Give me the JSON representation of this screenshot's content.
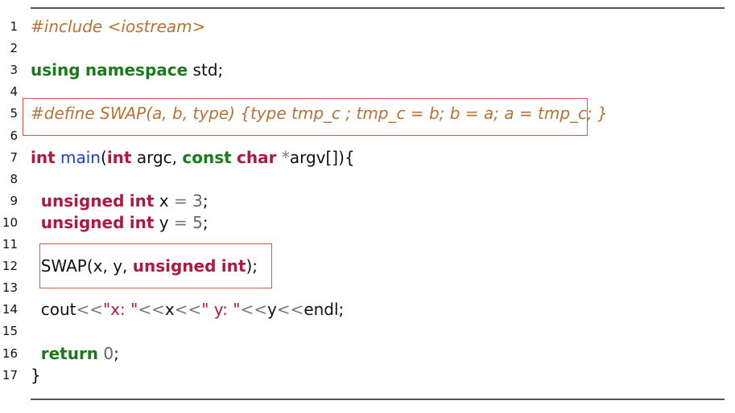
{
  "colors": {
    "preprocessor": "#b87333",
    "keyword_green": "#1b7a1b",
    "type_red": "#b0183d",
    "function_blue": "#1a3fd6",
    "operator_gray": "#777777",
    "number_gray": "#666666",
    "string_red": "#b0183d",
    "text": "#111111",
    "highlight_box": "#d9534f"
  },
  "lines": [
    {
      "n": "1",
      "tokens": [
        {
          "t": "#include <iostream>",
          "c": "preprocessor",
          "s": "pp"
        }
      ]
    },
    {
      "n": "2",
      "tokens": []
    },
    {
      "n": "3",
      "tokens": [
        {
          "t": "using",
          "c": "keyword_green",
          "s": "kw"
        },
        {
          "t": " ",
          "c": "text"
        },
        {
          "t": "namespace",
          "c": "keyword_green",
          "s": "kw"
        },
        {
          "t": " std;",
          "c": "text"
        }
      ]
    },
    {
      "n": "4",
      "tokens": []
    },
    {
      "n": "5",
      "tokens": [
        {
          "t": "#define SWAP(a, b, type) {type tmp_c ; tmp_c = b; b = a; a = tmp_c; }",
          "c": "preprocessor",
          "s": "pp"
        }
      ]
    },
    {
      "n": "6",
      "tokens": []
    },
    {
      "n": "7",
      "tokens": [
        {
          "t": "int",
          "c": "type_red",
          "s": "kw"
        },
        {
          "t": " ",
          "c": "text"
        },
        {
          "t": "main",
          "c": "function_blue"
        },
        {
          "t": "(",
          "c": "text"
        },
        {
          "t": "int",
          "c": "type_red",
          "s": "kw"
        },
        {
          "t": " argc, ",
          "c": "text"
        },
        {
          "t": "const",
          "c": "keyword_green",
          "s": "kw"
        },
        {
          "t": " ",
          "c": "text"
        },
        {
          "t": "char",
          "c": "type_red",
          "s": "kw"
        },
        {
          "t": " ",
          "c": "text"
        },
        {
          "t": "*",
          "c": "operator_gray"
        },
        {
          "t": "argv[]){",
          "c": "text"
        }
      ]
    },
    {
      "n": "8",
      "tokens": []
    },
    {
      "n": "9",
      "tokens": [
        {
          "t": "  ",
          "c": "text"
        },
        {
          "t": "unsigned",
          "c": "type_red",
          "s": "kw"
        },
        {
          "t": " ",
          "c": "text"
        },
        {
          "t": "int",
          "c": "type_red",
          "s": "kw"
        },
        {
          "t": " x ",
          "c": "text"
        },
        {
          "t": "=",
          "c": "operator_gray"
        },
        {
          "t": " ",
          "c": "text"
        },
        {
          "t": "3",
          "c": "number_gray"
        },
        {
          "t": ";",
          "c": "text"
        }
      ]
    },
    {
      "n": "10",
      "tokens": [
        {
          "t": "  ",
          "c": "text"
        },
        {
          "t": "unsigned",
          "c": "type_red",
          "s": "kw"
        },
        {
          "t": " ",
          "c": "text"
        },
        {
          "t": "int",
          "c": "type_red",
          "s": "kw"
        },
        {
          "t": " y ",
          "c": "text"
        },
        {
          "t": "=",
          "c": "operator_gray"
        },
        {
          "t": " ",
          "c": "text"
        },
        {
          "t": "5",
          "c": "number_gray"
        },
        {
          "t": ";",
          "c": "text"
        }
      ]
    },
    {
      "n": "11",
      "tokens": []
    },
    {
      "n": "12",
      "tokens": [
        {
          "t": "  SWAP(x, y, ",
          "c": "text"
        },
        {
          "t": "unsigned",
          "c": "type_red",
          "s": "kw"
        },
        {
          "t": " ",
          "c": "text"
        },
        {
          "t": "int",
          "c": "type_red",
          "s": "kw"
        },
        {
          "t": ");",
          "c": "text"
        }
      ]
    },
    {
      "n": "13",
      "tokens": []
    },
    {
      "n": "14",
      "tokens": [
        {
          "t": "  cout",
          "c": "text"
        },
        {
          "t": "<<",
          "c": "operator_gray"
        },
        {
          "t": "\"x: \"",
          "c": "string_red"
        },
        {
          "t": "<<",
          "c": "operator_gray"
        },
        {
          "t": "x",
          "c": "text"
        },
        {
          "t": "<<",
          "c": "operator_gray"
        },
        {
          "t": "\" y: \"",
          "c": "string_red"
        },
        {
          "t": "<<",
          "c": "operator_gray"
        },
        {
          "t": "y",
          "c": "text"
        },
        {
          "t": "<<",
          "c": "operator_gray"
        },
        {
          "t": "endl;",
          "c": "text"
        }
      ]
    },
    {
      "n": "15",
      "tokens": []
    },
    {
      "n": "16",
      "tokens": [
        {
          "t": "  ",
          "c": "text"
        },
        {
          "t": "return",
          "c": "keyword_green",
          "s": "kw"
        },
        {
          "t": " ",
          "c": "text"
        },
        {
          "t": "0",
          "c": "number_gray"
        },
        {
          "t": ";",
          "c": "text"
        }
      ]
    },
    {
      "n": "17",
      "tokens": [
        {
          "t": "}",
          "c": "text"
        }
      ]
    }
  ]
}
